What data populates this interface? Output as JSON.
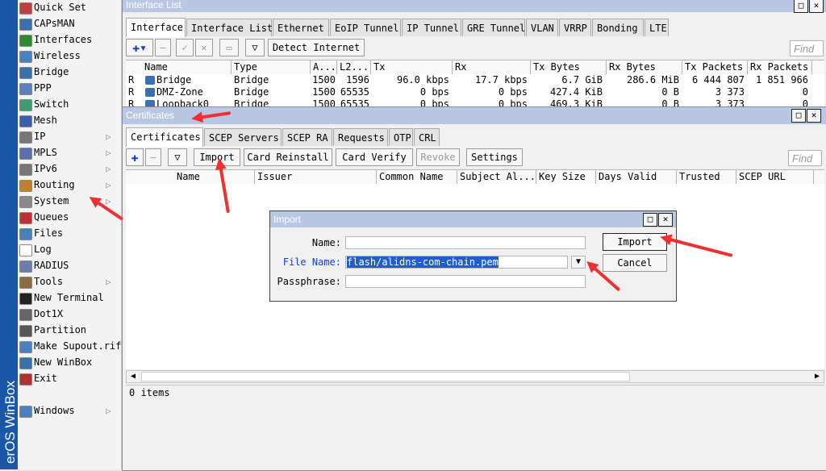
{
  "brand": {
    "text": "erOS WinBox"
  },
  "menu": {
    "items": [
      {
        "label": "Quick Set",
        "icon": "quick-set-icon",
        "color": "#c04040",
        "sub": false
      },
      {
        "label": "CAPsMAN",
        "icon": "capsman-icon",
        "color": "#3a6fb0",
        "sub": false
      },
      {
        "label": "Interfaces",
        "icon": "interfaces-icon",
        "color": "#2e8b2e",
        "sub": false
      },
      {
        "label": "Wireless",
        "icon": "wireless-icon",
        "color": "#4a7fc0",
        "sub": false
      },
      {
        "label": "Bridge",
        "icon": "bridge-icon",
        "color": "#3a6fb0",
        "sub": false
      },
      {
        "label": "PPP",
        "icon": "ppp-icon",
        "color": "#5a80c0",
        "sub": false
      },
      {
        "label": "Switch",
        "icon": "switch-icon",
        "color": "#3c9e6e",
        "sub": false
      },
      {
        "label": "Mesh",
        "icon": "mesh-icon",
        "color": "#3a5fb0",
        "sub": false
      },
      {
        "label": "IP",
        "icon": "ip-icon",
        "color": "#777777",
        "sub": true
      },
      {
        "label": "MPLS",
        "icon": "mpls-icon",
        "color": "#5a6fb0",
        "sub": true
      },
      {
        "label": "IPv6",
        "icon": "ipv6-icon",
        "color": "#777777",
        "sub": true
      },
      {
        "label": "Routing",
        "icon": "routing-icon",
        "color": "#c08030",
        "sub": true
      },
      {
        "label": "System",
        "icon": "system-icon",
        "color": "#8a8a8a",
        "sub": true
      },
      {
        "label": "Queues",
        "icon": "queues-icon",
        "color": "#c03030",
        "sub": false
      },
      {
        "label": "Files",
        "icon": "files-icon",
        "color": "#4a7fc0",
        "sub": false
      },
      {
        "label": "Log",
        "icon": "log-icon",
        "color": "#ffffff",
        "sub": false
      },
      {
        "label": "RADIUS",
        "icon": "radius-icon",
        "color": "#6a7fb0",
        "sub": false
      },
      {
        "label": "Tools",
        "icon": "tools-icon",
        "color": "#8a6a40",
        "sub": true
      },
      {
        "label": "New Terminal",
        "icon": "terminal-icon",
        "color": "#222222",
        "sub": false
      },
      {
        "label": "Dot1X",
        "icon": "dot1x-icon",
        "color": "#666666",
        "sub": false
      },
      {
        "label": "Partition",
        "icon": "partition-icon",
        "color": "#555555",
        "sub": false
      },
      {
        "label": "Make Supout.rif",
        "icon": "supout-icon",
        "color": "#4a7fc0",
        "sub": false
      },
      {
        "label": "New WinBox",
        "icon": "winbox-icon",
        "color": "#3a6fb0",
        "sub": false
      },
      {
        "label": "Exit",
        "icon": "exit-icon",
        "color": "#b03030",
        "sub": false
      },
      {
        "label": "Windows",
        "icon": "windows-icon",
        "color": "#4a7fc0",
        "sub": true
      }
    ]
  },
  "iface": {
    "title": "Interface List",
    "tabs": [
      "Interface",
      "Interface List",
      "Ethernet",
      "EoIP Tunnel",
      "IP Tunnel",
      "GRE Tunnel",
      "VLAN",
      "VRRP",
      "Bonding",
      "LTE"
    ],
    "detect_label": "Detect Internet",
    "find_placeholder": "Find",
    "columns": [
      "Name",
      "Type",
      "A...",
      "L2...",
      "Tx",
      "Rx",
      "Tx Bytes",
      "Rx Bytes",
      "Tx Packets",
      "Rx Packets"
    ],
    "rows": [
      {
        "flag": "R",
        "name": "Bridge",
        "type": "Bridge",
        "mtu": "1500",
        "l2mtu": "1596",
        "tx": "96.0 kbps",
        "rx": "17.7 kbps",
        "txb": "6.7 GiB",
        "rxb": "286.6 MiB",
        "txp": "6 444 807",
        "rxp": "1 851 966"
      },
      {
        "flag": "R",
        "name": "DMZ-Zone",
        "type": "Bridge",
        "mtu": "1500",
        "l2mtu": "65535",
        "tx": "0 bps",
        "rx": "0 bps",
        "txb": "427.4 KiB",
        "rxb": "0 B",
        "txp": "3 373",
        "rxp": "0"
      },
      {
        "flag": "R",
        "name": "Loopback0",
        "type": "Bridge",
        "mtu": "1500",
        "l2mtu": "65535",
        "tx": "0 bps",
        "rx": "0 bps",
        "txb": "469.3 KiB",
        "rxb": "0 B",
        "txp": "3 373",
        "rxp": "0"
      }
    ]
  },
  "certs": {
    "title": "Certificates",
    "tabs": [
      "Certificates",
      "SCEP Servers",
      "SCEP RA",
      "Requests",
      "OTP",
      "CRL"
    ],
    "buttons": [
      "Import",
      "Card Reinstall",
      "Card Verify",
      "Revoke",
      "Settings"
    ],
    "find_placeholder": "Find",
    "columns": [
      "Name",
      "Issuer",
      "Common Name",
      "Subject Al...",
      "Key Size",
      "Days Valid",
      "Trusted",
      "SCEP URL"
    ],
    "status": "0 items"
  },
  "import_dialog": {
    "title": "Import",
    "name_label": "Name:",
    "name_value": "",
    "file_label": "File Name:",
    "file_value": "flash/alidns-com-chain.pem",
    "pass_label": "Passphrase:",
    "pass_value": "",
    "import_label": "Import",
    "cancel_label": "Cancel"
  },
  "colors": {
    "annotation": "#f03030",
    "file_label": "#1a3fcf",
    "selection": "#1f5ecf"
  }
}
